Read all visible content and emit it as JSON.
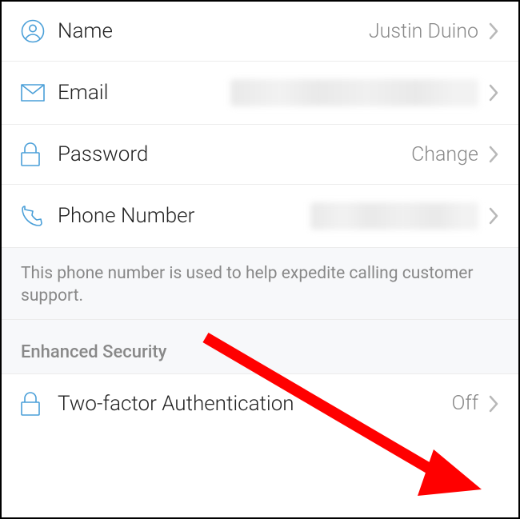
{
  "rows": {
    "name": {
      "label": "Name",
      "value": "Justin Duino"
    },
    "email": {
      "label": "Email"
    },
    "password": {
      "label": "Password",
      "value": "Change"
    },
    "phone": {
      "label": "Phone Number"
    },
    "twofa": {
      "label": "Two-factor Authentication",
      "value": "Off"
    }
  },
  "note": "This phone number is used to help expedite calling customer support.",
  "sectionHeader": "Enhanced Security",
  "colors": {
    "iconStroke": "#4a9fd8",
    "chevron": "#b8b8b8",
    "arrow": "#ff0000"
  }
}
